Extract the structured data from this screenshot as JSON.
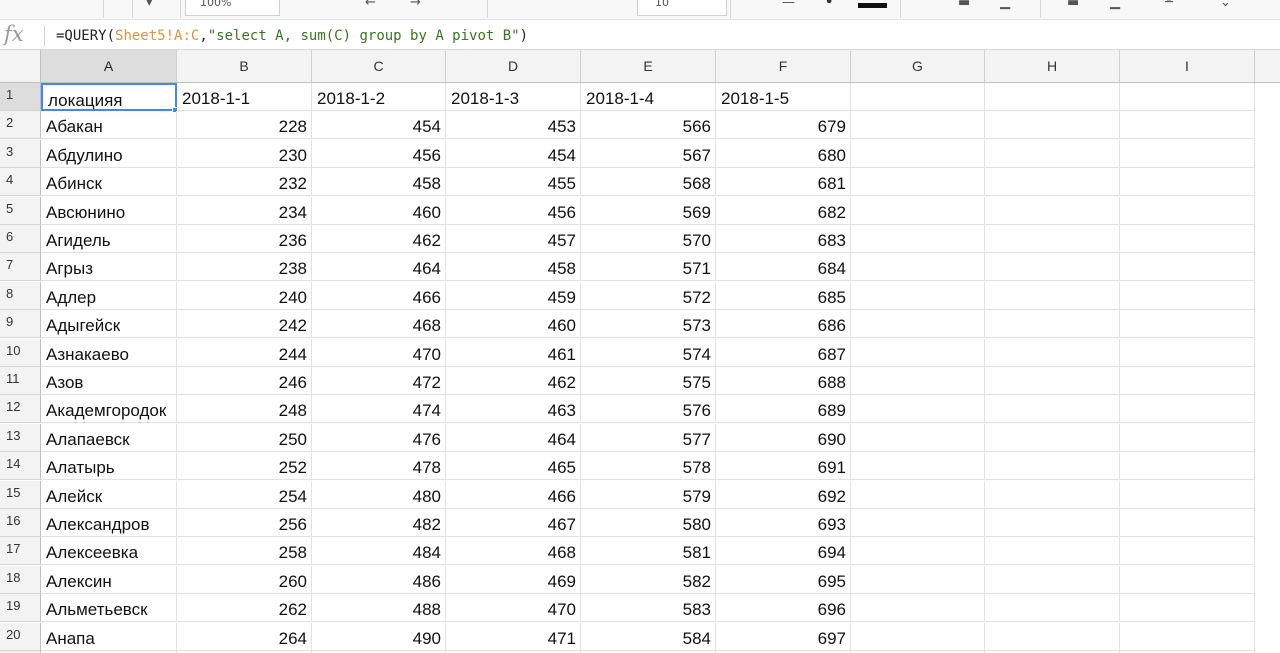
{
  "toolbar": {
    "zoom_value": "100%",
    "font_size_value": "10",
    "undo_icon": "arrow-left-icon",
    "redo_icon": "arrow-right-icon"
  },
  "formula_bar": {
    "fx_label": "fx",
    "formula_prefix": "=QUERY(",
    "formula_ref": "Sheet5!A:C",
    "formula_comma": ",",
    "formula_string": "\"select A, sum(C) group by A pivot B\"",
    "formula_suffix": ")"
  },
  "columns": [
    "A",
    "B",
    "C",
    "D",
    "E",
    "F",
    "G",
    "H",
    "I"
  ],
  "selected_column": "A",
  "selected_cell": "A1",
  "header_row": {
    "row_number": "1",
    "cells": [
      "локацияя",
      "2018-1-1",
      "2018-1-2",
      "2018-1-3",
      "2018-1-4",
      "2018-1-5"
    ]
  },
  "rows": [
    {
      "row_number": "2",
      "location": "Абакан",
      "values": [
        "228",
        "454",
        "453",
        "566",
        "679"
      ]
    },
    {
      "row_number": "3",
      "location": "Абдулино",
      "values": [
        "230",
        "456",
        "454",
        "567",
        "680"
      ]
    },
    {
      "row_number": "4",
      "location": "Абинск",
      "values": [
        "232",
        "458",
        "455",
        "568",
        "681"
      ]
    },
    {
      "row_number": "5",
      "location": "Авсюнино",
      "values": [
        "234",
        "460",
        "456",
        "569",
        "682"
      ]
    },
    {
      "row_number": "6",
      "location": "Агидель",
      "values": [
        "236",
        "462",
        "457",
        "570",
        "683"
      ]
    },
    {
      "row_number": "7",
      "location": "Агрыз",
      "values": [
        "238",
        "464",
        "458",
        "571",
        "684"
      ]
    },
    {
      "row_number": "8",
      "location": "Адлер",
      "values": [
        "240",
        "466",
        "459",
        "572",
        "685"
      ]
    },
    {
      "row_number": "9",
      "location": "Адыгейск",
      "values": [
        "242",
        "468",
        "460",
        "573",
        "686"
      ]
    },
    {
      "row_number": "10",
      "location": "Азнакаево",
      "values": [
        "244",
        "470",
        "461",
        "574",
        "687"
      ]
    },
    {
      "row_number": "11",
      "location": "Азов",
      "values": [
        "246",
        "472",
        "462",
        "575",
        "688"
      ]
    },
    {
      "row_number": "12",
      "location": "Академгородок",
      "values": [
        "248",
        "474",
        "463",
        "576",
        "689"
      ]
    },
    {
      "row_number": "13",
      "location": "Алапаевск",
      "values": [
        "250",
        "476",
        "464",
        "577",
        "690"
      ]
    },
    {
      "row_number": "14",
      "location": "Алатырь",
      "values": [
        "252",
        "478",
        "465",
        "578",
        "691"
      ]
    },
    {
      "row_number": "15",
      "location": "Алейск",
      "values": [
        "254",
        "480",
        "466",
        "579",
        "692"
      ]
    },
    {
      "row_number": "16",
      "location": "Александров",
      "values": [
        "256",
        "482",
        "467",
        "580",
        "693"
      ]
    },
    {
      "row_number": "17",
      "location": "Алексеевка",
      "values": [
        "258",
        "484",
        "468",
        "581",
        "694"
      ]
    },
    {
      "row_number": "18",
      "location": "Алексин",
      "values": [
        "260",
        "486",
        "469",
        "582",
        "695"
      ]
    },
    {
      "row_number": "19",
      "location": "Альметьевск",
      "values": [
        "262",
        "488",
        "470",
        "583",
        "696"
      ]
    },
    {
      "row_number": "20",
      "location": "Анапа",
      "values": [
        "264",
        "490",
        "471",
        "584",
        "697"
      ]
    }
  ],
  "colors": {
    "selection": "#4285f4",
    "header_bg": "#f3f3f3",
    "formula_ref": "#e69138",
    "formula_string": "#38761d"
  }
}
